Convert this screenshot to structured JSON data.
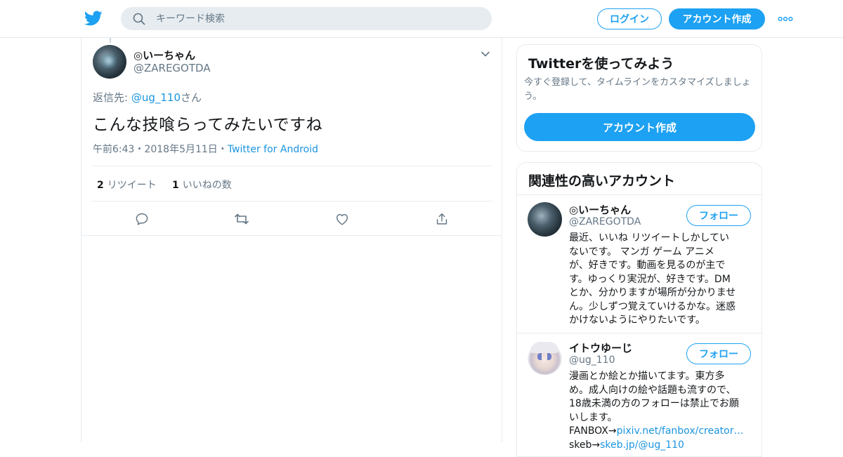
{
  "header": {
    "search_placeholder": "キーワード検索",
    "login_label": "ログイン",
    "signup_label": "アカウント作成"
  },
  "tweet": {
    "display_name": "◎いーちゃん",
    "handle": "@ZAREGOTDA",
    "reply_prefix": "返信先: ",
    "reply_to": "@ug_110",
    "reply_suffix": "さん",
    "text": "こんな技喰らってみたいですね",
    "time": "午前6:43",
    "date": "2018年5月11日",
    "source": "Twitter for Android",
    "retweet_count": "2",
    "retweet_label": "リツイート",
    "like_count": "1",
    "like_label": "いいねの数",
    "separator": "・"
  },
  "signup_card": {
    "title": "Twitterを使ってみよう",
    "description": "今すぐ登録して、タイムラインをカスタマイズしましょう。",
    "button_label": "アカウント作成"
  },
  "related": {
    "title": "関連性の高いアカウント",
    "follow_label": "フォロー",
    "accounts": [
      {
        "name": "◎いーちゃん",
        "handle": "@ZAREGOTDA",
        "bio_lines": [
          "最近、いいね リツイートしかしてい",
          "ないです。 マンガ ゲーム アニメ",
          "が、好きです。動画を見るのが主で",
          "す。ゆっくり実況が、好きです。DM",
          "とか、分かりますが場所が分かりませ",
          "ん。少しずつ覚えていけるかな。迷惑",
          "かけないようにやりたいです。"
        ]
      },
      {
        "name": "イトウゆーじ",
        "handle": "@ug_110",
        "bio_lines": [
          "漫画とか絵とか描いてます。東方多",
          "め。成人向けの絵や話題も流すので、",
          "18歳未満の方のフォローは禁止でお願",
          "いします。"
        ],
        "fanbox_prefix": "FANBOX→",
        "fanbox_link": "pixiv.net/fanbox/creator…",
        "skeb_prefix": "skeb→",
        "skeb_link": "skeb.jp/@ug_110"
      }
    ]
  },
  "colors": {
    "accent": "#1da1f2",
    "link": "#1b95e0",
    "muted": "#657786",
    "border": "#e6ecf0"
  }
}
